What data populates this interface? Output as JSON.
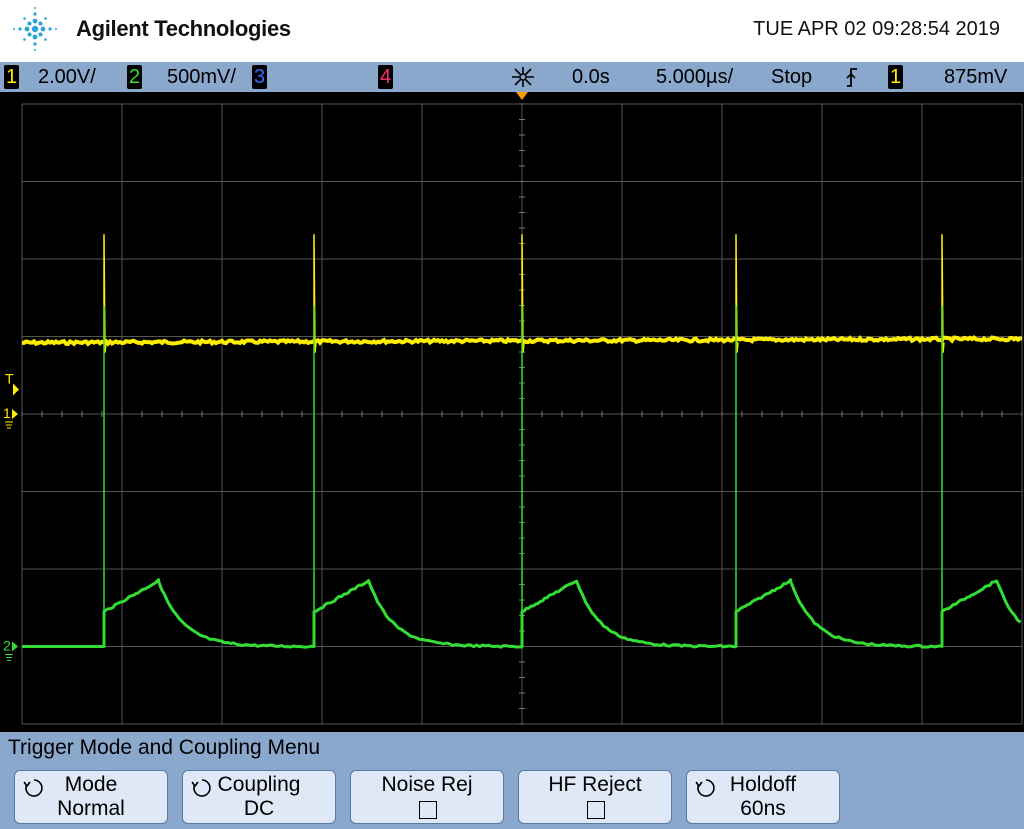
{
  "header": {
    "brand": "Agilent Technologies",
    "datetime": "TUE APR 02 09:28:54 2019"
  },
  "status": {
    "ch1_num": "1",
    "ch1_scale": "2.00V/",
    "ch2_num": "2",
    "ch2_scale": "500mV/",
    "ch3_num": "3",
    "ch4_num": "4",
    "time_delay": "0.0s",
    "time_scale": "5.000µs/",
    "run_state": "Stop",
    "trig_edge": "f",
    "trig_src": "1",
    "trig_level": "875mV"
  },
  "markers": {
    "trigger": "T",
    "ch1": "1",
    "ch2": "2"
  },
  "colors": {
    "ch1": "#ffee00",
    "ch2": "#33dd33",
    "ch3": "#3b6bff",
    "ch4": "#ff3070",
    "status_bg": "#8aa7cc",
    "softkey_bg": "#dfe8f6",
    "trigger_marker": "#ff9900"
  },
  "menu": {
    "title": "Trigger Mode and Coupling Menu",
    "softkeys": [
      {
        "label": "Mode",
        "value": "Normal",
        "icon": "rotary-knob-icon"
      },
      {
        "label": "Coupling",
        "value": "DC",
        "icon": "rotary-knob-icon"
      },
      {
        "label": "Noise Rej",
        "value": "",
        "icon": "checkbox-icon"
      },
      {
        "label": "HF Reject",
        "value": "",
        "icon": "checkbox-icon"
      },
      {
        "label": "Holdoff",
        "value": "60ns",
        "icon": "rotary-knob-icon"
      }
    ]
  },
  "chart_data": {
    "type": "line",
    "grid": true,
    "x_divisions": 10,
    "y_divisions": 8,
    "time_per_div_us": 5,
    "pulse_edges_us": [
      4.1,
      14.6,
      25.0,
      35.7,
      46.0
    ],
    "series": [
      {
        "name": "1",
        "color": "#ffee00",
        "volts_per_div": 2.0,
        "level_div": 0.92,
        "spike_div": 1.4
      },
      {
        "name": "2",
        "color": "#33dd33",
        "volts_per_div": 0.5,
        "baseline_div": -3.0,
        "step_div": 0.45,
        "peak_div": 0.85,
        "spike_div": 4.4
      }
    ]
  }
}
